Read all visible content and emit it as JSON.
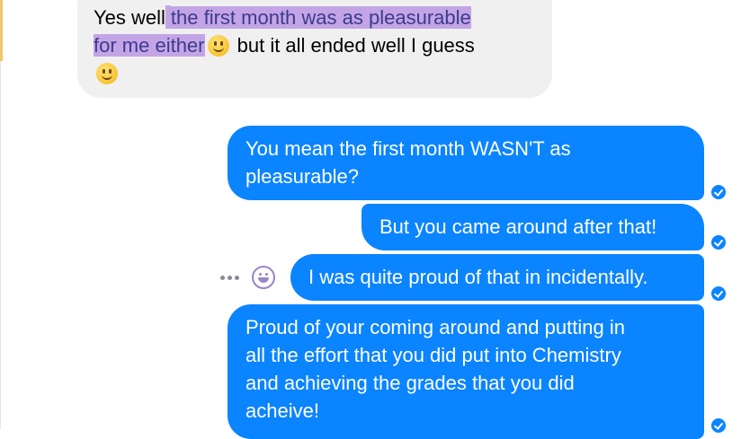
{
  "conversation": {
    "incoming": {
      "line1_plain": "Yes well",
      "line1_highlight": "the first month was as pleasurable",
      "line2_highlight": "for me either",
      "line2_plain": "but it all ended well I guess",
      "emoji": "slightly-smiling-face-emoji"
    },
    "outgoing": [
      {
        "lines": [
          "You mean the first month WASN'T as",
          "pleasurable?"
        ],
        "status": "sent-check-icon"
      },
      {
        "lines": [
          "But you came around after that!"
        ],
        "status": "sent-check-icon"
      },
      {
        "lines": [
          "I was quite proud of that in incidentally."
        ],
        "status": "sent-check-icon"
      },
      {
        "lines": [
          "Proud of your coming around and putting in",
          "all the effort that you did put into Chemistry",
          "and achieving the grades that you did",
          "acheive!"
        ],
        "status": "sent-check-icon"
      }
    ],
    "hover_actions": {
      "more_icon": "more-dots-icon",
      "react_icon": "react-emoji-icon"
    }
  },
  "colors": {
    "outgoing_bubble": "#0b84ff",
    "incoming_bubble": "#f1f0f0",
    "highlight": "#c3a5e6",
    "highlight_text": "#3c3a8c",
    "left_accent": "#f3c66b"
  }
}
